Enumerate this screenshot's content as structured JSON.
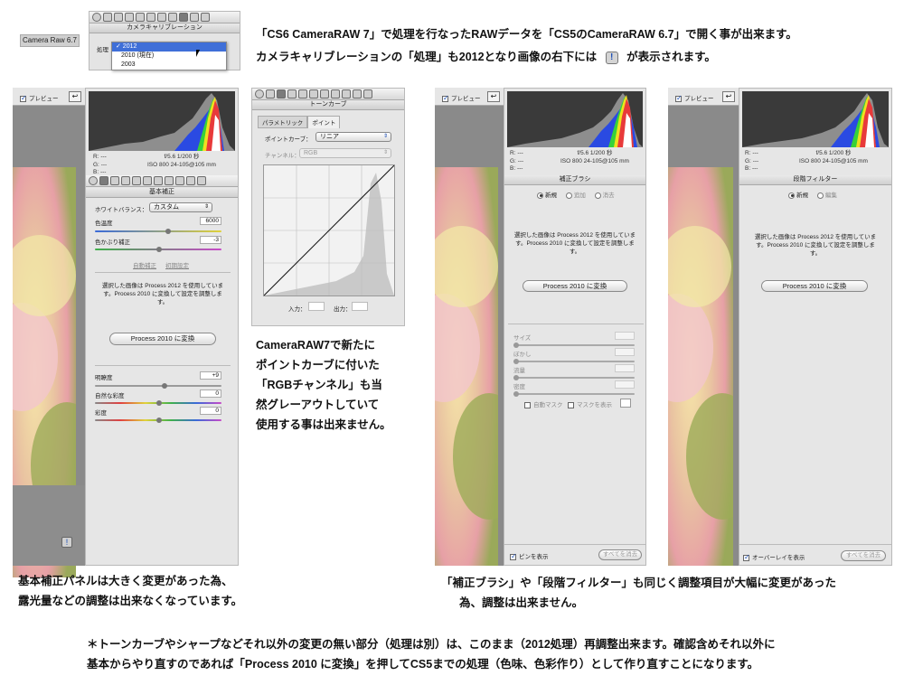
{
  "top": {
    "version_label": "Camera Raw 6.7",
    "calib_header": "カメラキャリブレーション",
    "process_label": "処理",
    "process_options": [
      "✓ 2012",
      "2010 (現在)",
      "2003"
    ],
    "caption_line1": "「CS6 CameraRAW 7」で処理を行なったRAWデータを「CS5のCameraRAW 6.7」で開く事が出来ます。",
    "caption_line2_a": "カメラキャリブレーションの「処理」も2012となり画像の右下には",
    "caption_line2_b": "が表示されます。",
    "warning_glyph": "!"
  },
  "panels": {
    "preview_label": "プレビュー",
    "rgb_r": "R:",
    "rgb_g": "G:",
    "rgb_b": "B:",
    "rgb_dashes": "---",
    "exif_line1": "f/5.6   1/200 秒",
    "exif_line2": "ISO 800   24-105@105 mm",
    "convert_message": "選択した画像は Process 2012 を使用しています。Process 2010 に変換して設定を調整します。",
    "convert_button": "Process 2010 に変換",
    "warning_glyph": "!"
  },
  "basic": {
    "header": "基本補正",
    "wb_label": "ホワイトバランス：",
    "wb_value": "カスタム",
    "temp_label": "色温度",
    "temp_value": "6000",
    "tint_label": "色かぶり補正",
    "tint_value": "-3",
    "auto_link": "自動補正",
    "default_link": "初期設定",
    "clarity_label": "明瞭度",
    "clarity_value": "+9",
    "vibrance_label": "自然な彩度",
    "vibrance_value": "0",
    "saturation_label": "彩度",
    "saturation_value": "0"
  },
  "tone": {
    "header": "トーンカーブ",
    "tab_parametric": "パラメトリック",
    "tab_point": "ポイント",
    "curve_label": "ポイントカーブ：",
    "curve_value": "リニア",
    "channel_label": "チャンネル：",
    "channel_value": "RGB",
    "input_label": "入力：",
    "output_label": "出力："
  },
  "brush": {
    "header": "補正ブラシ",
    "mode_new": "新規",
    "mode_add": "追加",
    "mode_erase": "消去",
    "size_label": "サイズ",
    "feather_label": "ぼかし",
    "flow_label": "流量",
    "density_label": "密度",
    "automask_label": "自動マスク",
    "showmask_label": "マスクを表示",
    "show_pins_label": "ピンを表示",
    "clear_all": "すべてを消去"
  },
  "grad": {
    "header": "段階フィルター",
    "mode_new": "新規",
    "mode_edit": "編集",
    "overlay_label": "オーバーレイを表示",
    "clear_all": "すべてを消去"
  },
  "notes": {
    "tone_note": [
      "CameraRAW7で新たに",
      "ポイントカーブに付いた",
      "「RGBチャンネル」も当",
      "然グレーアウトしていて",
      "使用する事は出来ません。"
    ],
    "basic_note": [
      "基本補正パネルは大きく変更があった為、",
      "露光量などの調整は出来なくなっています。"
    ],
    "brush_note": [
      "「補正ブラシ」や「段階フィルター」も同じく調整項目が大幅に変更があった",
      "為、調整は出来ません。"
    ],
    "footer": [
      "＊トーンカーブやシャープなどそれ以外の変更の無い部分（処理は別）は、このまま（2012処理）再調整出来ます。確認含めそれ以外に",
      "基本からやり直すのであれば「Process 2010 に変換」を押してCS5までの処理（色味、色彩作り）として作り直すことになります。"
    ]
  },
  "colors": {
    "panel_bg": "#e6e6e6",
    "menu_highlight": "#3f6fd8",
    "slider_temp_start": "#3a6ad8",
    "slider_temp_end": "#e0d23a",
    "slider_tint_start": "#3fb04a",
    "slider_tint_end": "#c84ac8"
  }
}
